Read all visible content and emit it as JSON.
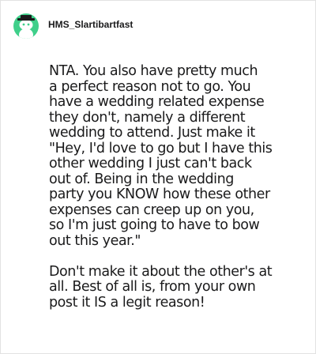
{
  "post": {
    "username": "HMS_Slartibartfast",
    "avatar_icon": "snoo-avatar-icon",
    "avatar_color": "#3fcf8a",
    "paragraphs": [
      "NTA. You also have pretty much\na perfect reason not to go. You\nhave a wedding related expense\nthey don't, namely a different\nwedding to attend. Just make it\n\"Hey, I'd love to go but I have this\nother wedding I just can't back\nout of. Being in the wedding\nparty you KNOW how these other\nexpenses can creep up on you,\nso I'm just going to have to bow\nout this year.\"",
      "Don't make it about the other's at\nall. Best of all is, from your own\npost it IS a legit reason!"
    ]
  }
}
